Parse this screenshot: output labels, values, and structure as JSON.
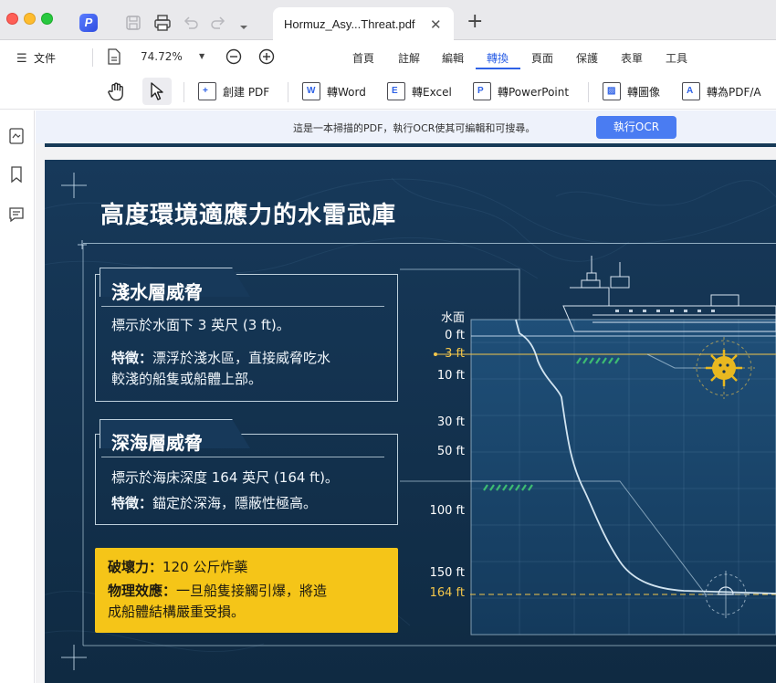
{
  "window": {
    "tab_title": "Hormuz_Asy...Threat.pdf",
    "tab_close": "✕",
    "new_tab": "+"
  },
  "menubar": {
    "file_label": "文件",
    "zoom": "74.72%",
    "items": [
      {
        "label": "首頁"
      },
      {
        "label": "註解"
      },
      {
        "label": "編輯"
      },
      {
        "label": "轉換",
        "active": true
      },
      {
        "label": "頁面"
      },
      {
        "label": "保護"
      },
      {
        "label": "表單"
      },
      {
        "label": "工具"
      }
    ]
  },
  "toolbar": {
    "buttons": [
      {
        "letter": "+",
        "label": "創建 PDF"
      },
      {
        "letter": "W",
        "label": "轉Word"
      },
      {
        "letter": "E",
        "label": "轉Excel"
      },
      {
        "letter": "P",
        "label": "轉PowerPoint"
      },
      {
        "letter": "▨",
        "label": "轉圖像"
      },
      {
        "letter": "A",
        "label": "轉為PDF/A"
      }
    ]
  },
  "ocr_banner": {
    "text": "這是一本掃描的PDF，執行OCR使其可編輯和可搜尋。",
    "button": "執行OCR"
  },
  "document": {
    "heading": "高度環境適應力的水雷武庫",
    "shallow": {
      "title": "淺水層威脅",
      "line1": "標示於水面下 3 英尺 (3 ft)。",
      "feature_label": "特徵：",
      "line2": "漂浮於淺水區，直接威脅吃水",
      "line3": "較淺的船隻或船體上部。"
    },
    "deep": {
      "title": "深海層威脅",
      "line1": "標示於海床深度 164 英尺 (164 ft)。",
      "feature_label": "特徵：",
      "line2": "錨定於深海，隱蔽性極高。"
    },
    "impact": {
      "label1": "破壞力：",
      "value1": "120 公斤炸藥",
      "label2": "物理效應：",
      "value2": "一旦船隻接觸引爆，將造",
      "value3": "成船體結構嚴重受損。"
    },
    "depth_labels": {
      "surface": "水面",
      "d0": "0 ft",
      "d3": "3 ft",
      "d10": "10 ft",
      "d30": "30 ft",
      "d50": "50 ft",
      "d100": "100 ft",
      "d150": "150 ft",
      "d164": "164 ft"
    },
    "colors": {
      "page_bg": "#13324d",
      "highlight": "#f3c64a",
      "impact_card": "#f5c518",
      "mine": "#e8b820"
    }
  }
}
